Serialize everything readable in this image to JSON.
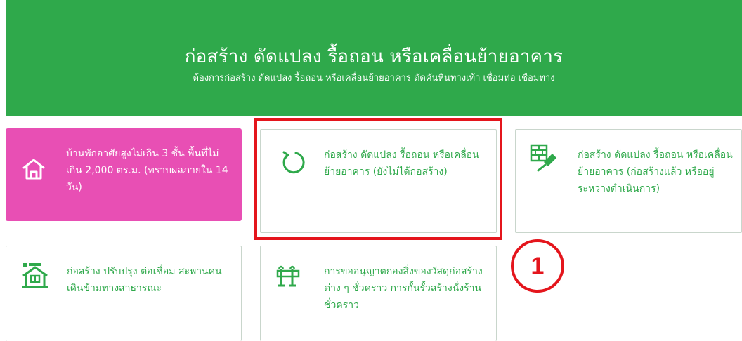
{
  "hero": {
    "title": "ก่อสร้าง ดัดแปลง รื้อถอน หรือเคลื่อนย้ายอาคาร",
    "subtitle": "ต้องการก่อสร้าง ดัดแปลง รื้อถอน หรือเคลื่อนย้ายอาคาร ตัดคันหินทางเท้า เชื่อมท่อ เชื่อมทาง"
  },
  "cards": [
    {
      "label": "บ้านพักอาศัยสูงไม่เกิน 3 ชั้น พื้นที่ไม่เกิน 2,000 ตร.ม. (ทราบผลภายใน 14 วัน)",
      "icon": "house-icon",
      "color": "#e84fb4"
    },
    {
      "label": "ก่อสร้าง ดัดแปลง รื้อถอน หรือเคลื่อนย้ายอาคาร (ยังไม่ได้ก่อสร้าง)",
      "icon": "refresh-icon",
      "color": "#2fa94b"
    },
    {
      "label": "ก่อสร้าง ดัดแปลง รื้อถอน หรือเคลื่อนย้ายอาคาร (ก่อสร้างแล้ว หรืออยู่ระหว่างดำเนินการ)",
      "icon": "brick-trowel-icon",
      "color": "#2fa94b"
    },
    {
      "label": "ก่อสร้าง ปรับปรุง ต่อเชื่อม สะพานคนเดินข้ามทางสาธารณะ",
      "icon": "building-icon",
      "color": "#2fa94b"
    },
    {
      "label": "การขออนุญาตกองสิ่งของวัสดุก่อสร้างต่าง ๆ ชั่วคราว การกั้นรั้วสร้างนั่งร้านชั่วคราว",
      "icon": "barrier-icon",
      "color": "#2fa94b"
    }
  ],
  "annotation": {
    "step": "1",
    "color": "#e4151c"
  }
}
